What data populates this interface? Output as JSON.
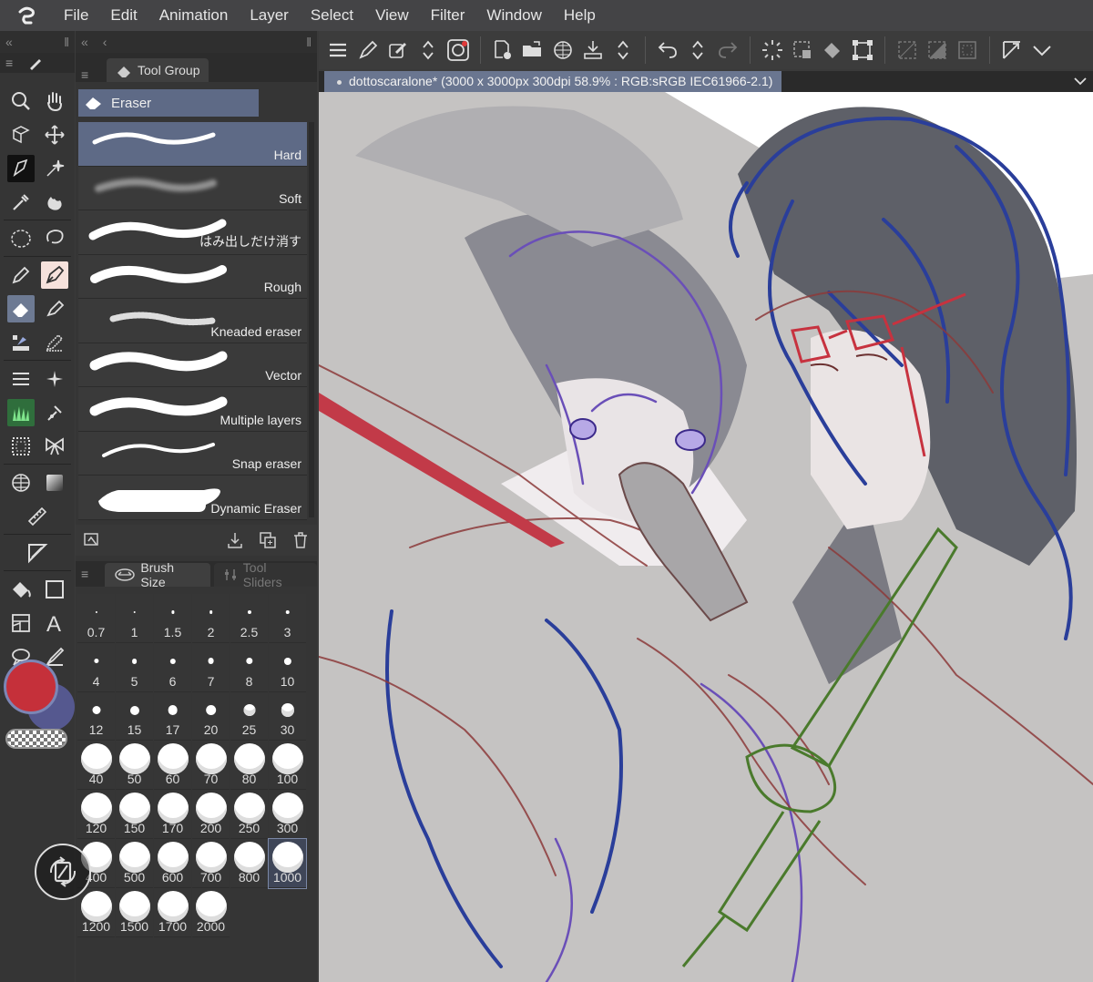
{
  "menu": [
    "File",
    "Edit",
    "Animation",
    "Layer",
    "Select",
    "View",
    "Filter",
    "Window",
    "Help"
  ],
  "panels": {
    "tool_group_tab": "Tool Group",
    "sub_tool_group": "Eraser"
  },
  "eraser_brushes": [
    {
      "label": "Hard",
      "selected": true
    },
    {
      "label": "Soft"
    },
    {
      "label": "はみ出しだけ消す"
    },
    {
      "label": "Rough"
    },
    {
      "label": "Kneaded eraser"
    },
    {
      "label": "Vector"
    },
    {
      "label": "Multiple layers"
    },
    {
      "label": "Snap eraser"
    },
    {
      "label": "Dynamic Eraser"
    }
  ],
  "brush_size": {
    "tab_label": "Brush Size",
    "tab2_label": "Tool Sliders",
    "sizes": [
      "0.7",
      "1",
      "1.5",
      "2",
      "2.5",
      "3",
      "4",
      "5",
      "6",
      "7",
      "8",
      "10",
      "12",
      "15",
      "17",
      "20",
      "25",
      "30",
      "40",
      "50",
      "60",
      "70",
      "80",
      "100",
      "120",
      "150",
      "170",
      "200",
      "250",
      "300",
      "400",
      "500",
      "600",
      "700",
      "800",
      "1000",
      "1200",
      "1500",
      "1700",
      "2000"
    ],
    "selected": "1000"
  },
  "document": {
    "tab_title": "dottoscaralone* (3000 x 3000px 300dpi 58.9% : RGB:sRGB IEC61966-2.1)"
  },
  "colors": {
    "main": "#c5303a",
    "sub": "#55588f",
    "selection": "#5e6a86"
  },
  "icons": {
    "tools": [
      "zoom-icon",
      "hand-icon",
      "3d-move-icon",
      "move-icon",
      "operation-icon",
      "auto-select-icon",
      "eyedropper-icon",
      "blend-icon",
      "marquee-icon",
      "lasso-icon",
      "pen-icon",
      "ink-pen-icon",
      "eraser-icon",
      "marker-icon",
      "pattern-brush-icon",
      "pencil-icon",
      "lines-icon",
      "sparkle-icon",
      "grass-brush-icon",
      "fill-tool-icon",
      "texture-icon",
      "ribbon-icon",
      "grid-icon",
      "gradient-icon",
      "ruler-icon",
      "triangle-icon",
      "bucket-icon",
      "square-icon",
      "frame-icon",
      "text-icon",
      "balloon-icon",
      "correction-icon"
    ]
  }
}
